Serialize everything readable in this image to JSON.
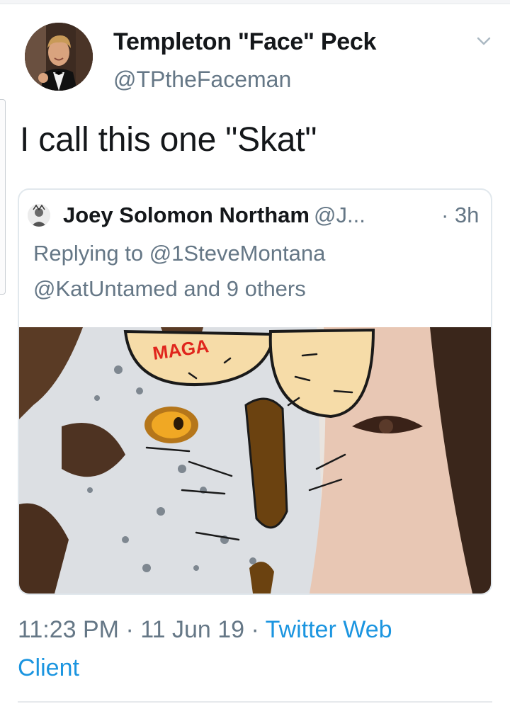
{
  "author": {
    "display_name": "Templeton \"Face\" Peck",
    "handle": "@TPtheFaceman"
  },
  "tweet": {
    "text": "I call this one \"Skat\""
  },
  "quoted": {
    "display_name": "Joey Solomon Northam",
    "handle": "@J...",
    "time": "· 3h",
    "replying_line1": "Replying to @1SteveMontana",
    "replying_line2": "@KatUntamed and 9 others",
    "image_text": "MAGA"
  },
  "meta": {
    "timestamp": "11:23 PM · 11 Jun 19 · ",
    "source_part1": "Twitter Web",
    "source_part2": "Client"
  },
  "icons": {
    "menu": "chevron-down-icon"
  },
  "colors": {
    "link": "#1b95e0",
    "secondary_text": "#657786",
    "primary_text": "#14171a",
    "card_border": "#e1e8ed"
  }
}
